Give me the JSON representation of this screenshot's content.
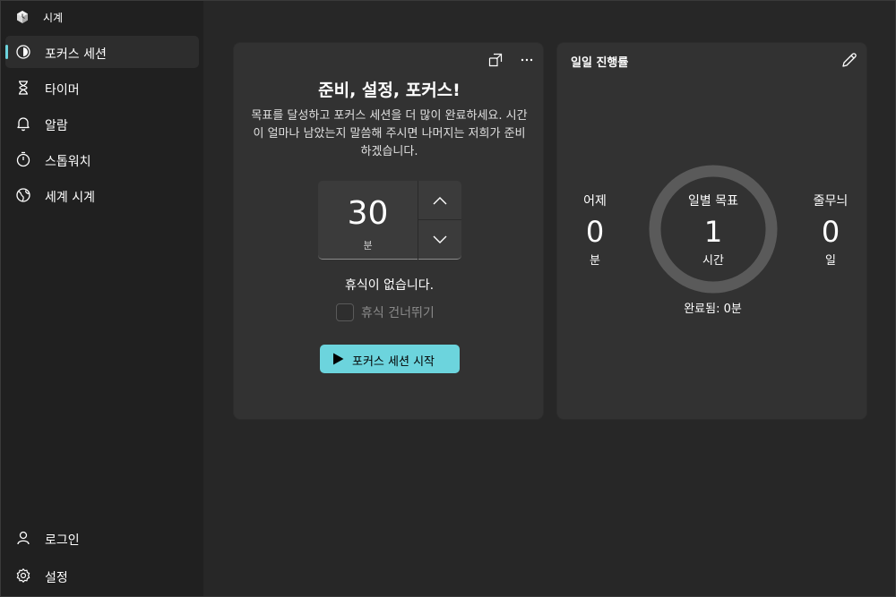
{
  "app": {
    "title": "시계"
  },
  "sidebar": {
    "items": [
      {
        "label": "포커스 세션",
        "icon": "focus-icon",
        "active": true
      },
      {
        "label": "타이머",
        "icon": "hourglass-icon"
      },
      {
        "label": "알람",
        "icon": "bell-icon"
      },
      {
        "label": "스톱워치",
        "icon": "stopwatch-icon"
      },
      {
        "label": "세계 시계",
        "icon": "globe-icon"
      }
    ],
    "bottom": [
      {
        "label": "로그인",
        "icon": "person-icon"
      },
      {
        "label": "설정",
        "icon": "gear-icon"
      }
    ]
  },
  "focus": {
    "title": "준비, 설정, 포커스!",
    "description": "목표를 달성하고 포커스 세션을 더 많이 완료하세요. 시간이 얼마나 남았는지 말씀해 주시면 나머지는 저희가 준비하겠습니다.",
    "minutes": "30",
    "unit": "분",
    "break_text": "휴식이 없습니다.",
    "skip_break_label": "휴식 건너뛰기",
    "skip_break_checked": false,
    "start_label": "포커스 세션 시작"
  },
  "progress": {
    "title": "일일 진행률",
    "yesterday": {
      "label": "어제",
      "value": "0",
      "unit": "분"
    },
    "goal": {
      "label": "일별 목표",
      "value": "1",
      "unit": "시간",
      "fraction_complete": 0
    },
    "streak": {
      "label": "줄무늬",
      "value": "0",
      "unit": "일"
    },
    "completed": "완료됨: 0분"
  },
  "colors": {
    "accent": "#6cd4dd",
    "card": "#323232",
    "ring": "#5a5a5a"
  }
}
